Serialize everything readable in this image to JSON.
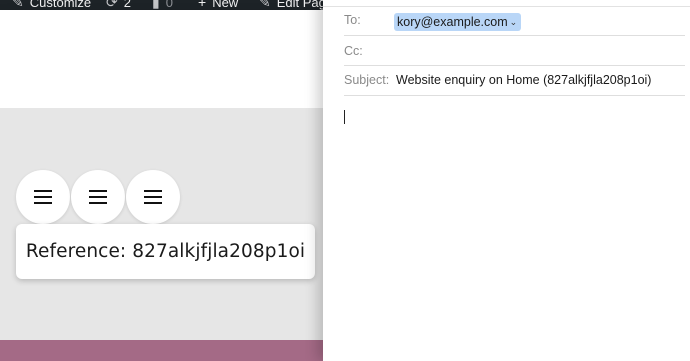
{
  "admin_bar": {
    "customize_label": "Customize",
    "updates_count": "2",
    "comments_count": "0",
    "new_label": "New",
    "edit_label": "Edit Page"
  },
  "page": {
    "reference_text": "Reference: 827alkjfjla208p1oi"
  },
  "compose": {
    "to_label": "To:",
    "to_value": "kory@example.com",
    "cc_label": "Cc:",
    "cc_value": "",
    "subject_label": "Subject:",
    "subject_value": "Website enquiry on Home (827alkjfjla208p1oi)",
    "body": ""
  },
  "colors": {
    "admin_bar_bg": "#1d2327",
    "token_highlight": "#b9d6f7",
    "footer_strip": "#a46a86"
  }
}
